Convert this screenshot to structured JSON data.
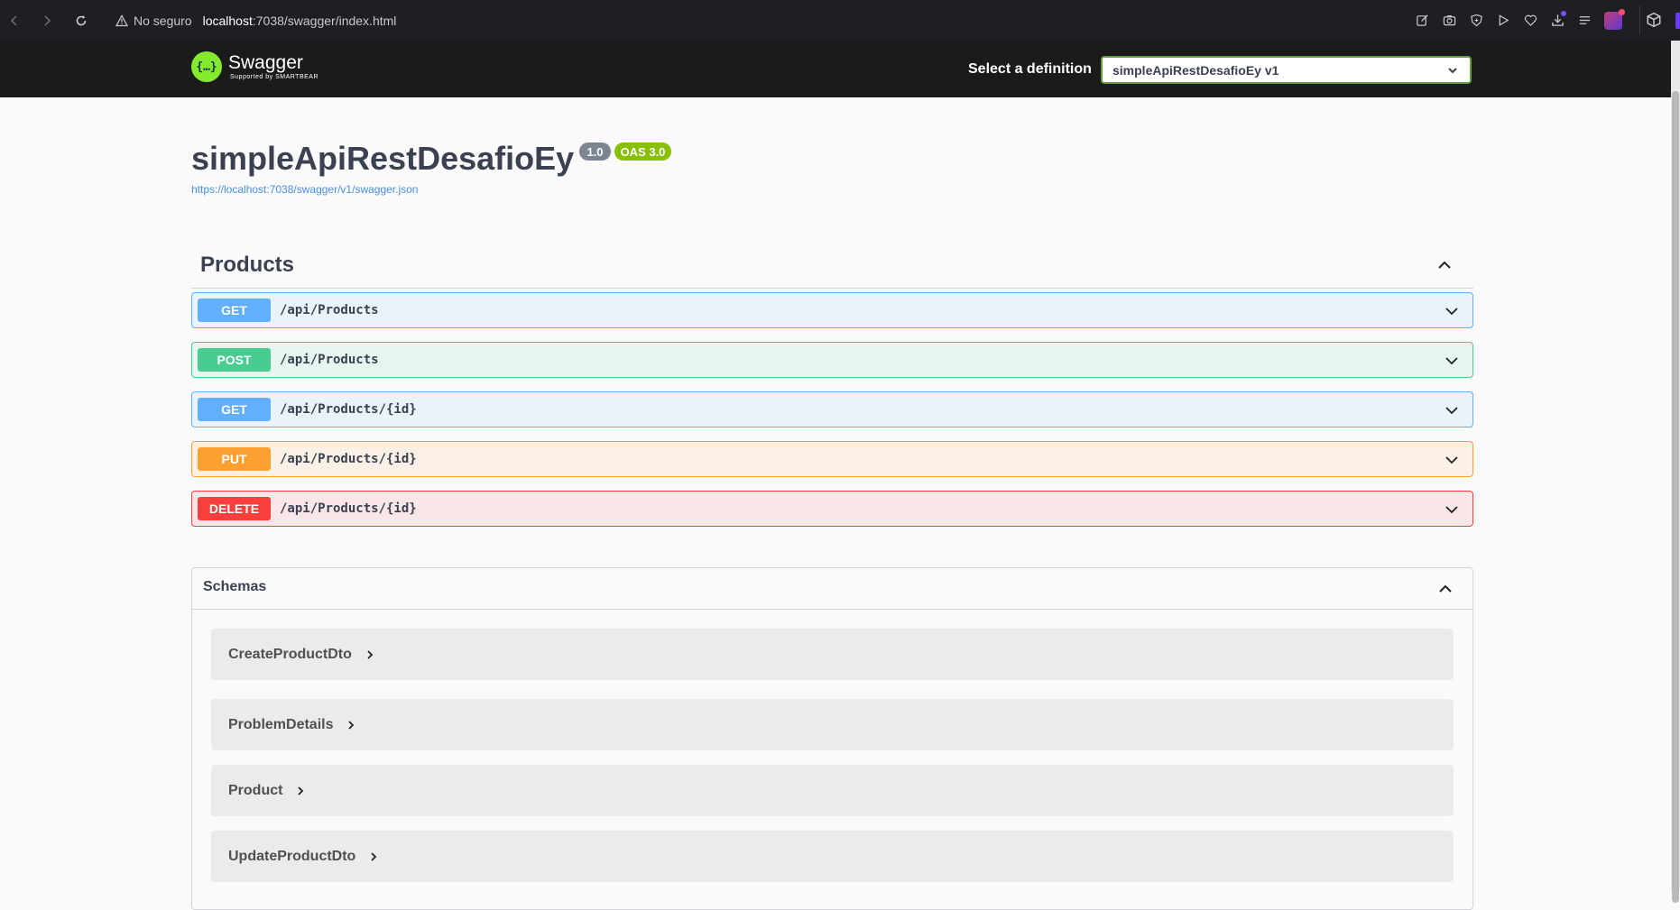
{
  "browser": {
    "security_label": "No seguro",
    "url_host": "localhost",
    "url_path": ":7038/swagger/index.html"
  },
  "topbar": {
    "logo_name": "Swagger",
    "logo_sub": "Supported by SMARTBEAR",
    "definition_label": "Select a definition",
    "definition_selected": "simpleApiRestDesafioEy v1"
  },
  "info": {
    "title": "simpleApiRestDesafioEy",
    "version_badge": "1.0",
    "oas_badge": "OAS 3.0",
    "spec_url": "https://localhost:7038/swagger/v1/swagger.json"
  },
  "tag": {
    "name": "Products"
  },
  "operations": [
    {
      "method": "GET",
      "path": "/api/Products",
      "color": "#61affe"
    },
    {
      "method": "POST",
      "path": "/api/Products",
      "color": "#49cc90"
    },
    {
      "method": "GET",
      "path": "/api/Products/{id}",
      "color": "#61affe"
    },
    {
      "method": "PUT",
      "path": "/api/Products/{id}",
      "color": "#fca130"
    },
    {
      "method": "DELETE",
      "path": "/api/Products/{id}",
      "color": "#f93e3e"
    }
  ],
  "schemas": {
    "title": "Schemas",
    "models": [
      {
        "name": "CreateProductDto"
      },
      {
        "name": "ProblemDetails"
      },
      {
        "name": "Product"
      },
      {
        "name": "UpdateProductDto"
      }
    ]
  },
  "icons": {
    "back": "arrow-left-icon",
    "forward": "arrow-right-icon",
    "reload": "reload-icon",
    "warning": "warning-icon",
    "expand": "chevron-down-icon",
    "collapse": "chevron-up-icon",
    "model_expand": "chevron-right-icon"
  }
}
